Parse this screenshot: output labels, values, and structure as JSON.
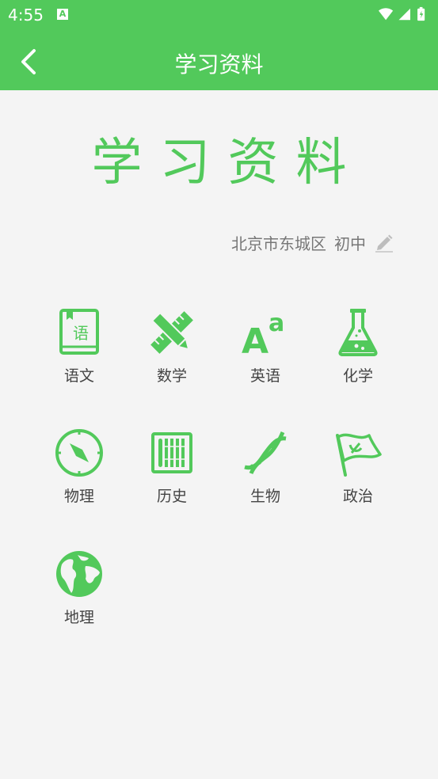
{
  "status_bar": {
    "time": "4:55",
    "a_badge": "A"
  },
  "app_bar": {
    "title": "学习资料"
  },
  "hero": {
    "title": "学习资料"
  },
  "location": {
    "region": "北京市东城区",
    "grade": "初中"
  },
  "subjects": [
    {
      "label": "语文",
      "icon": "book-icon"
    },
    {
      "label": "数学",
      "icon": "ruler-pencil-icon"
    },
    {
      "label": "英语",
      "icon": "letters-icon"
    },
    {
      "label": "化学",
      "icon": "flask-icon"
    },
    {
      "label": "物理",
      "icon": "compass-icon"
    },
    {
      "label": "历史",
      "icon": "bamboo-scroll-icon"
    },
    {
      "label": "生物",
      "icon": "dna-icon"
    },
    {
      "label": "政治",
      "icon": "flag-icon"
    },
    {
      "label": "地理",
      "icon": "globe-icon"
    }
  ],
  "colors": {
    "accent": "#52c95b",
    "background": "#f4f4f4",
    "text": "#444444"
  }
}
